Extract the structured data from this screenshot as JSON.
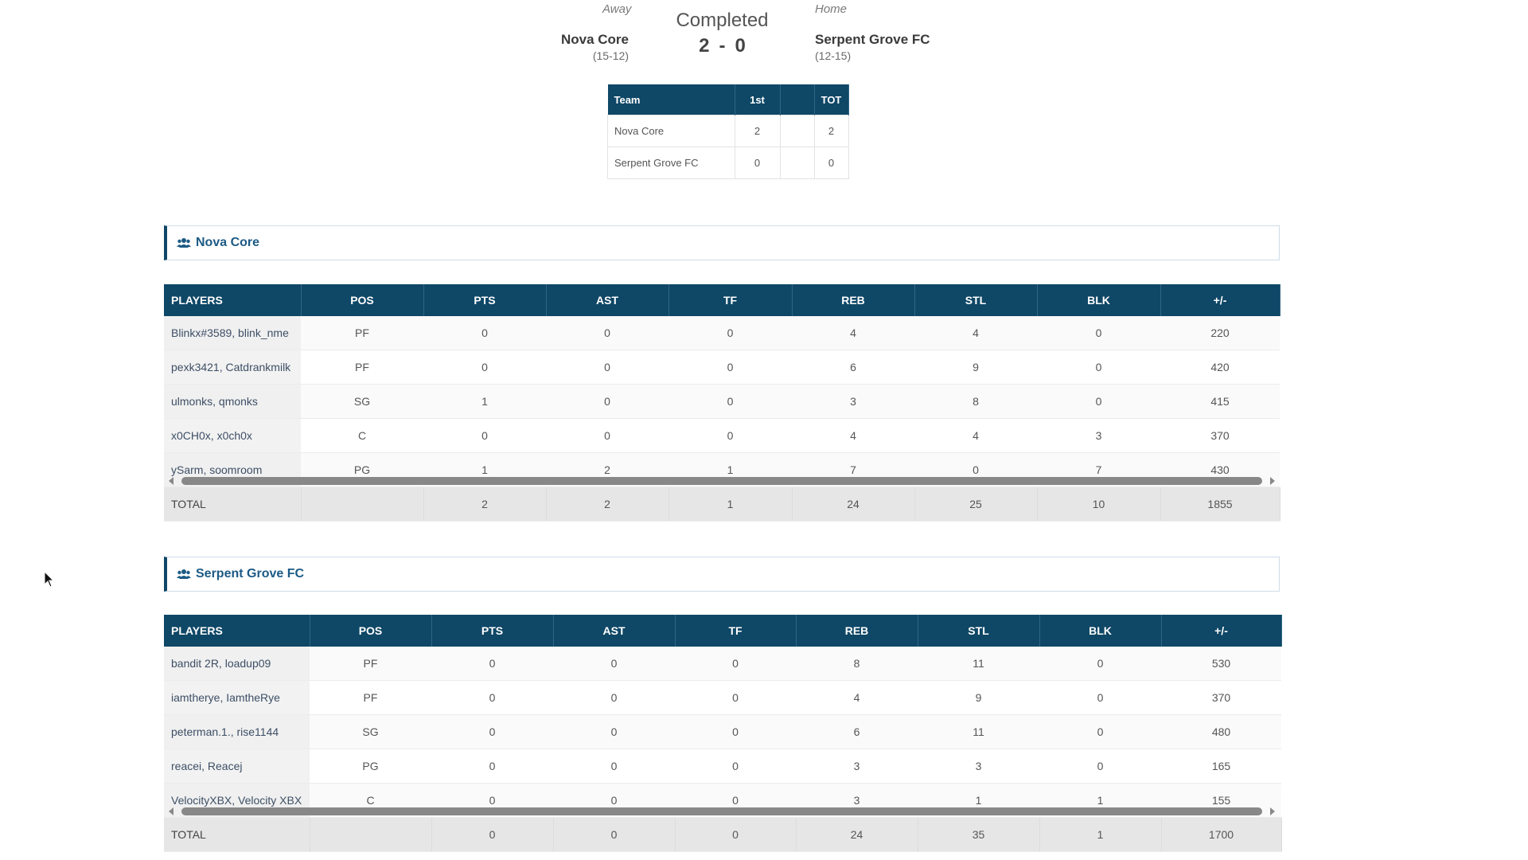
{
  "game": {
    "status": "Completed",
    "away": {
      "side_label": "Away",
      "name": "Nova Core",
      "record": "(15-12)",
      "score": "2"
    },
    "home": {
      "side_label": "Home",
      "name": "Serpent Grove FC",
      "record": "(12-15)",
      "score": "0"
    },
    "score_separator": "-"
  },
  "line_score": {
    "headers": [
      "Team",
      "1st",
      "",
      "TOT"
    ],
    "rows": [
      {
        "team": "Nova Core",
        "q1": "2",
        "q2": "",
        "tot": "2"
      },
      {
        "team": "Serpent Grove FC",
        "q1": "0",
        "q2": "",
        "tot": "0"
      }
    ]
  },
  "columns": [
    "PLAYERS",
    "POS",
    "PTS",
    "AST",
    "TF",
    "REB",
    "STL",
    "BLK",
    "+/-"
  ],
  "teams": [
    {
      "name": "Nova Core",
      "players": [
        [
          "Blinkx#3589, blink_nme",
          "PF",
          "0",
          "0",
          "0",
          "4",
          "4",
          "0",
          "220"
        ],
        [
          "pexk3421, Catdrankmilk",
          "PF",
          "0",
          "0",
          "0",
          "6",
          "9",
          "0",
          "420"
        ],
        [
          "ulmonks, qmonks",
          "SG",
          "1",
          "0",
          "0",
          "3",
          "8",
          "0",
          "415"
        ],
        [
          "x0CH0x, x0ch0x",
          "C",
          "0",
          "0",
          "0",
          "4",
          "4",
          "3",
          "370"
        ],
        [
          "ySarm, soomroom",
          "PG",
          "1",
          "2",
          "1",
          "7",
          "0",
          "7",
          "430"
        ]
      ],
      "total": [
        "TOTAL",
        "",
        "2",
        "2",
        "1",
        "24",
        "25",
        "10",
        "1855"
      ]
    },
    {
      "name": "Serpent Grove FC",
      "players": [
        [
          "bandit 2R, loadup09",
          "PF",
          "0",
          "0",
          "0",
          "8",
          "11",
          "0",
          "530"
        ],
        [
          "iamtherye, IamtheRye",
          "PF",
          "0",
          "0",
          "0",
          "4",
          "9",
          "0",
          "370"
        ],
        [
          "peterman.1., rise1144",
          "SG",
          "0",
          "0",
          "0",
          "6",
          "11",
          "0",
          "480"
        ],
        [
          "reacei, Reacej",
          "PG",
          "0",
          "0",
          "0",
          "3",
          "3",
          "0",
          "165"
        ],
        [
          "VelocityXBX, Velocity XBX",
          "C",
          "0",
          "0",
          "0",
          "3",
          "1",
          "1",
          "155"
        ]
      ],
      "total": [
        "TOTAL",
        "",
        "0",
        "0",
        "0",
        "24",
        "35",
        "1",
        "1700"
      ]
    }
  ],
  "icons": {
    "team_icon": "users-icon",
    "cursor": "mouse-pointer-icon"
  },
  "colors": {
    "header_bg": "#0f4766",
    "team_title": "#1c5a85"
  }
}
